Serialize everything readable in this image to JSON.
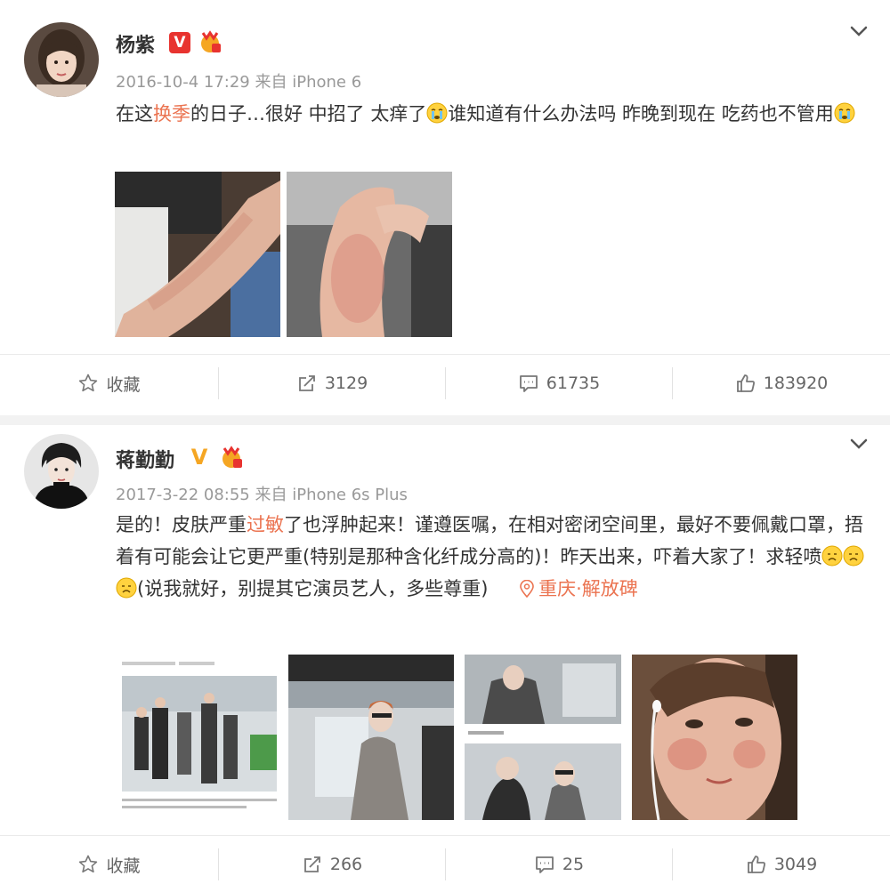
{
  "posts": [
    {
      "user": "杨紫",
      "badge": "V",
      "time": "2016-10-4 17:29",
      "source_prefix": "来自",
      "device": "iPhone 6",
      "text_before": "在这",
      "text_highlight": "换季",
      "text_mid1": "的日子…很好 中招了 太痒了",
      "text_mid2": "谁知道有什么办法吗 昨晚到现在 吃药也不管用",
      "actions": {
        "favorite": "收藏",
        "repost": "3129",
        "comment": "61735",
        "like": "183920"
      }
    },
    {
      "user": "蒋勤勤",
      "badge": "V",
      "time": "2017-3-22 08:55",
      "source_prefix": "来自",
      "device": "iPhone 6s Plus",
      "text_before": "是的！皮肤严重",
      "text_highlight": "过敏",
      "text_mid1": "了也浮肿起来！谨遵医嘱，在相对密闭空间里，最好不要佩戴口罩，捂着有可能会让它更严重(特别是那种含化纤成分高的)！昨天出来，吓着大家了！求轻喷",
      "text_mid2": "(说我就好，别提其它演员艺人，多些尊重)",
      "location": "重庆·解放碑",
      "actions": {
        "favorite": "收藏",
        "repost": "266",
        "comment": "25",
        "like": "3049"
      }
    }
  ],
  "colors": {
    "highlight": "#eb7350",
    "badge_red": "#e8332f",
    "badge_gold": "#f5a623",
    "meta": "#999999"
  },
  "icons": [
    "chevron-down-icon",
    "verified-v-icon",
    "medal-icon",
    "star-icon",
    "repost-icon",
    "comment-icon",
    "thumbs-up-icon",
    "location-icon",
    "crying-emoji-icon"
  ]
}
